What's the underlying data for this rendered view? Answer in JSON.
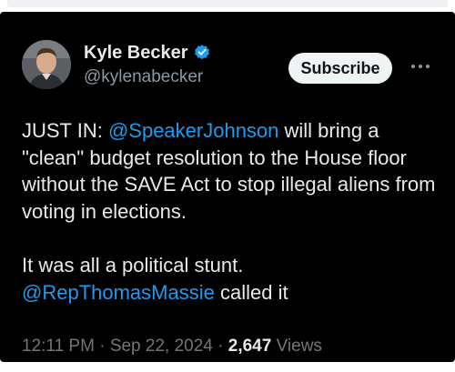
{
  "author": {
    "display_name": "Kyle Becker",
    "handle": "@kylenabecker",
    "verified_icon": "verified-badge-icon",
    "avatar": "profile-photo"
  },
  "actions": {
    "subscribe_label": "Subscribe",
    "more_icon": "more-options-icon"
  },
  "tweet": {
    "prefix": "JUST IN: ",
    "mention_1": "@SpeakerJohnson",
    "body_1": " will bring a \"clean\" budget resolution to the House floor without the SAVE Act to stop illegal aliens from voting in elections.",
    "body_2": "It was all a political stunt.",
    "mention_2": "@RepThomasMassie",
    "body_3": " called it"
  },
  "meta": {
    "time": "12:11 PM",
    "separator": "·",
    "date": "Sep 22, 2024",
    "views_count": "2,647",
    "views_label": "Views"
  },
  "colors": {
    "background": "#000000",
    "text": "#e7e9ea",
    "secondary_text": "#71767b",
    "mention": "#1d9bf0",
    "verified": "#1d9bf0",
    "subscribe_bg": "#eff3f4"
  }
}
